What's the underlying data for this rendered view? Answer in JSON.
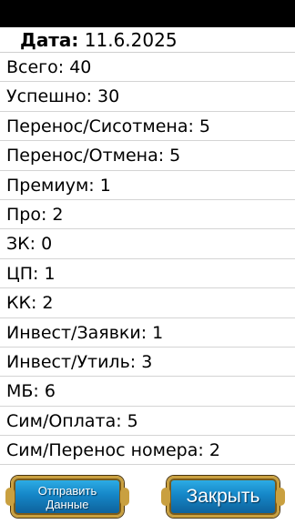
{
  "date": {
    "label": "Дата:",
    "value": "11.6.2025"
  },
  "rows": [
    "Всего: 40",
    "Успешно: 30",
    "Перенос/Сисотмена: 5",
    "Перенос/Отмена: 5",
    "Премиум: 1",
    "Про: 2",
    "ЗК: 0",
    "ЦП: 1",
    "КК: 2",
    "Инвест/Заявки: 1",
    "Инвест/Утиль: 3",
    "МБ: 6",
    "Сим/Оплата: 5",
    "Сим/Перенос номера: 2"
  ],
  "buttons": {
    "send_line1": "Отправить",
    "send_line2": "Данные",
    "close": "Закрыть"
  }
}
